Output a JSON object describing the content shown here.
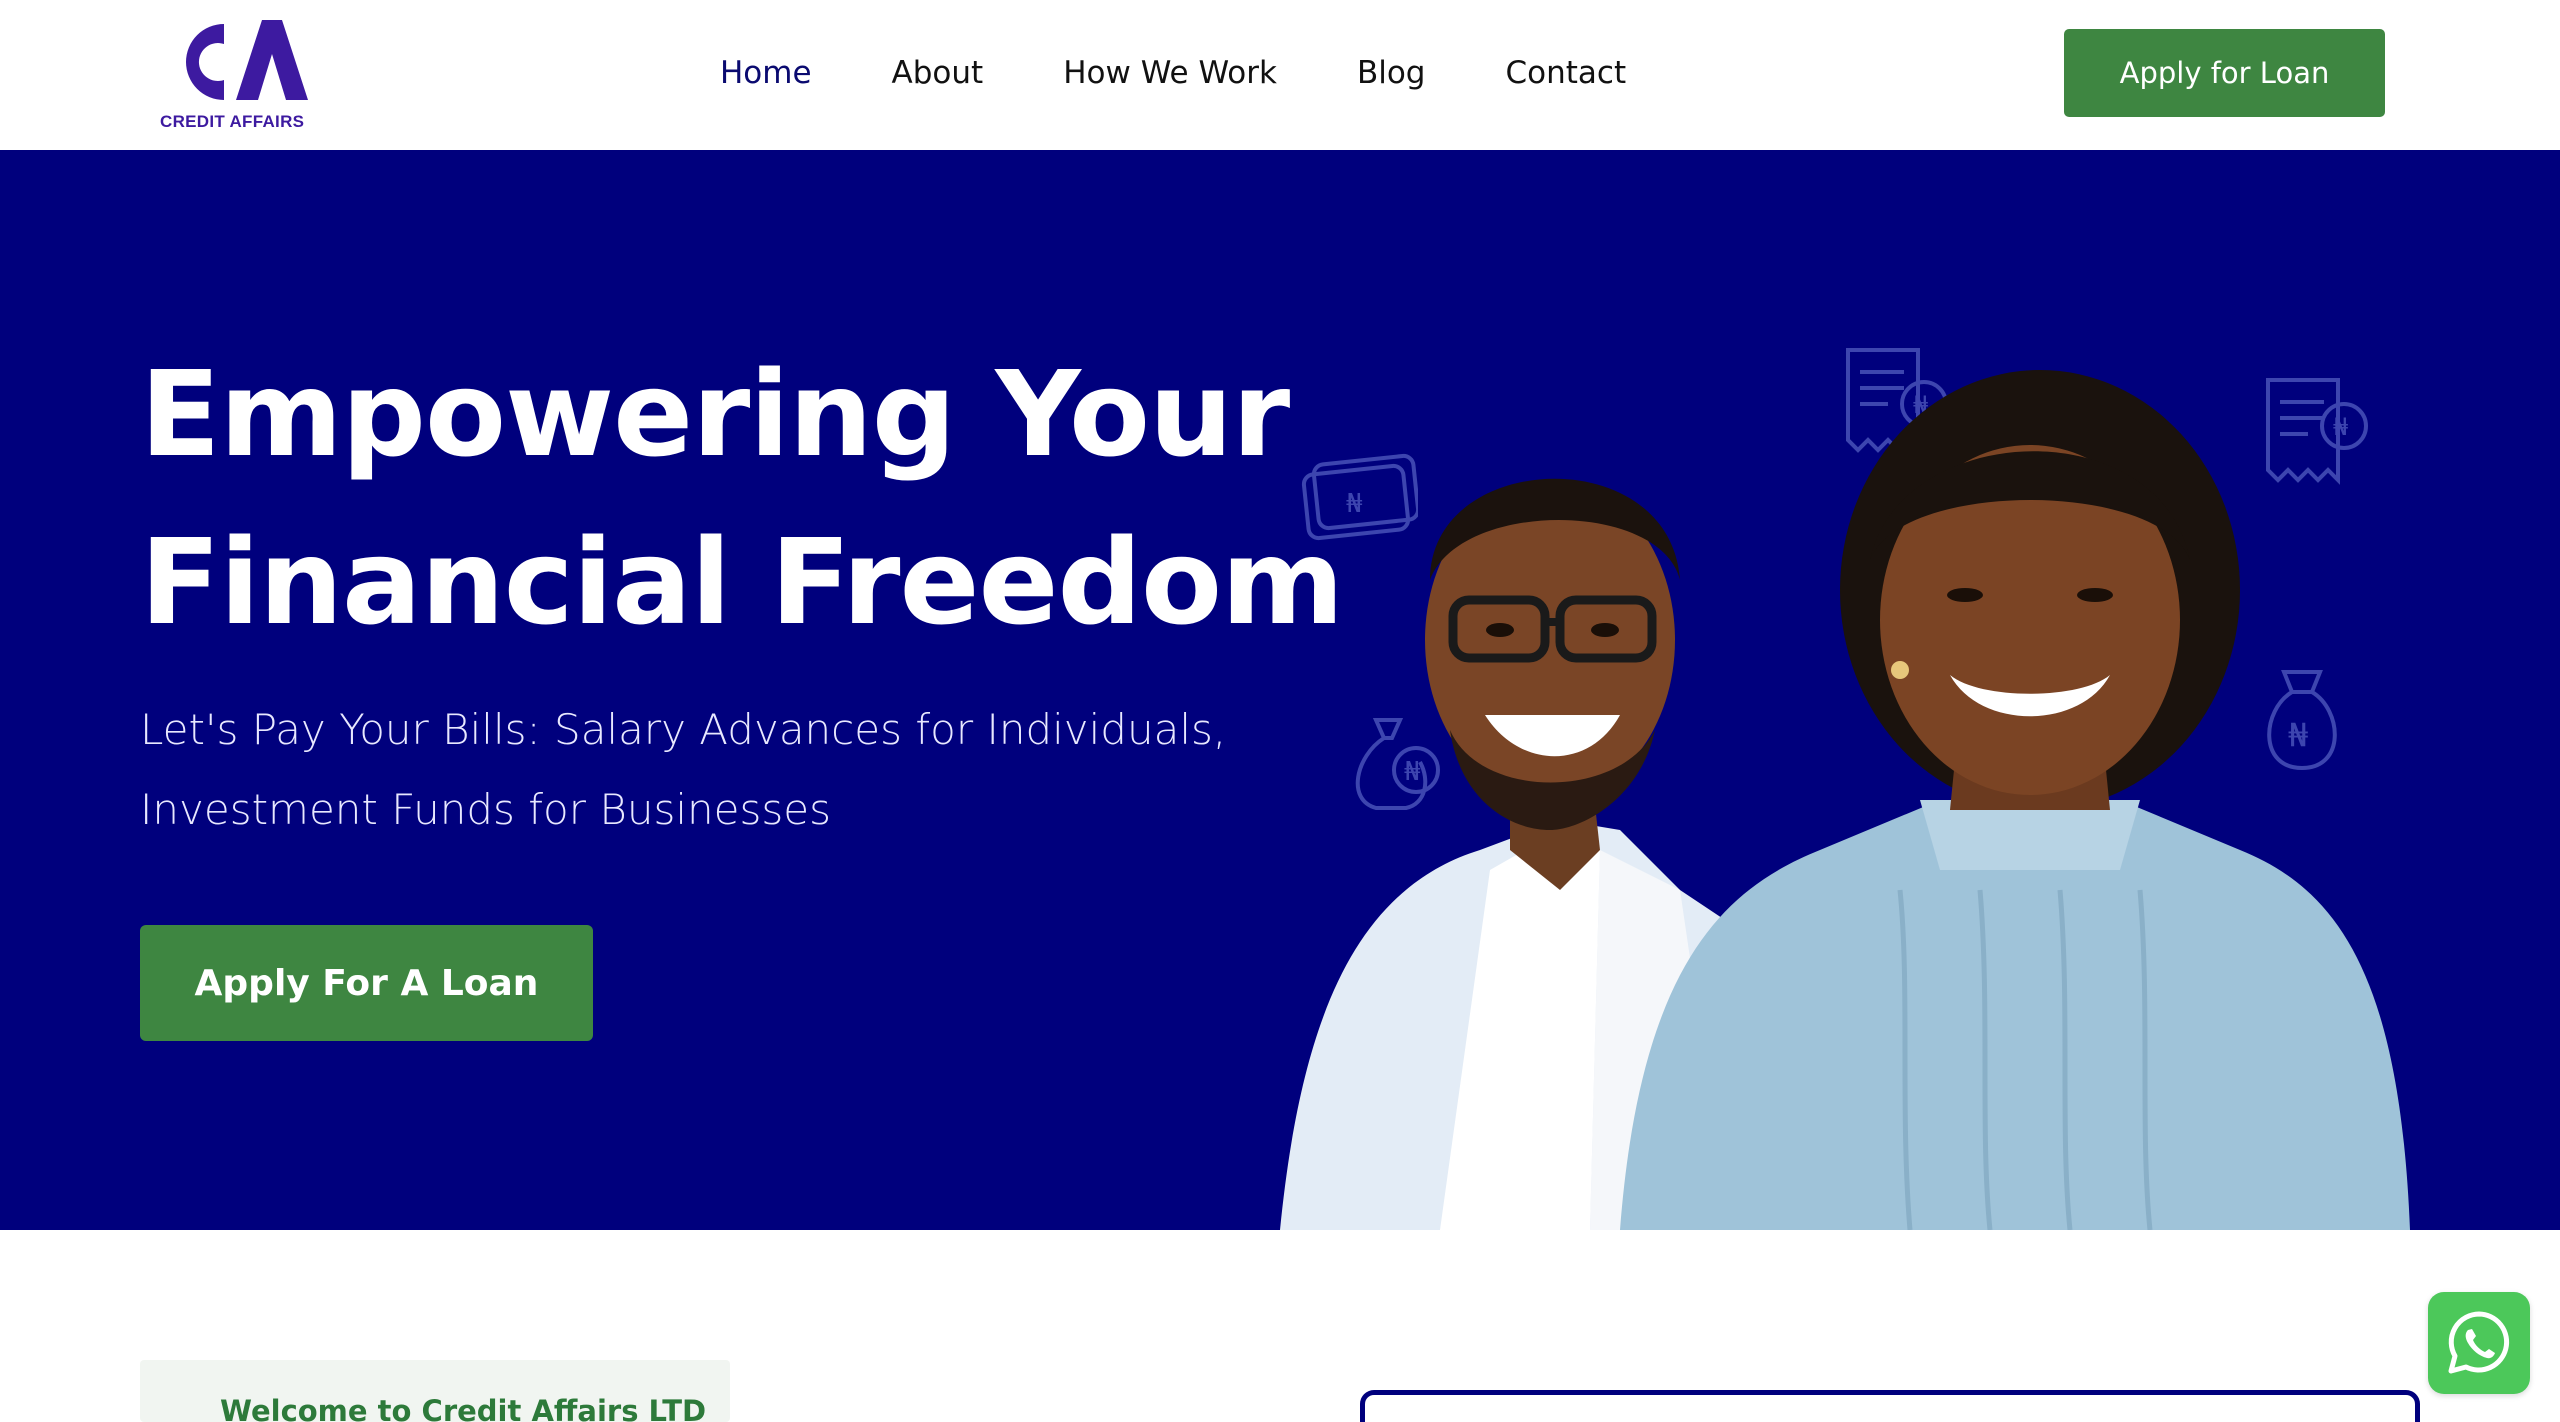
{
  "brand": {
    "logo_text": "CREDIT AFFAIRS",
    "logo_color": "#3d1aa0"
  },
  "nav": {
    "items": [
      {
        "label": "Home",
        "active": true
      },
      {
        "label": "About",
        "active": false
      },
      {
        "label": "How We Work",
        "active": false
      },
      {
        "label": "Blog",
        "active": false
      },
      {
        "label": "Contact",
        "active": false
      }
    ],
    "cta_label": "Apply for Loan"
  },
  "hero": {
    "title_line1": "Empowering Your",
    "title_line2": "Financial Freedom",
    "subtitle_line1": "Let's Pay Your Bills: Salary Advances for Individuals,",
    "subtitle_line2": "Investment Funds for Businesses",
    "cta_label": "Apply For A Loan",
    "background_color": "#00007d",
    "button_color": "#3e8641"
  },
  "welcome": {
    "tag_label": "Welcome to Credit Affairs LTD"
  },
  "floating": {
    "whatsapp_icon": "whatsapp-icon"
  }
}
